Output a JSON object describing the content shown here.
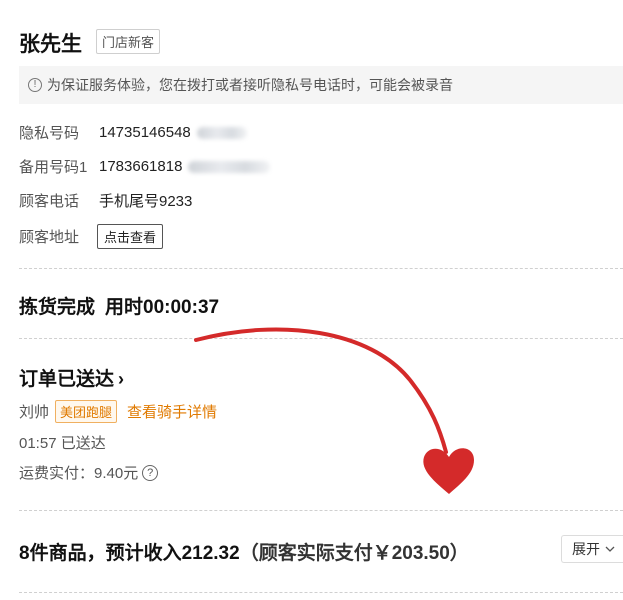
{
  "customer": {
    "name": "张先生",
    "tag": "门店新客",
    "notice": "为保证服务体验，您在拨打或者接听隐私号电话时，可能会被录音",
    "private_number_label": "隐私号码",
    "private_number": "14735146548",
    "backup_number_label": "备用号码1",
    "backup_number": "1783661818",
    "phone_label": "顾客电话",
    "phone_value": "手机尾号9233",
    "address_label": "顾客地址",
    "address_button": "点击查看"
  },
  "picking": {
    "status": "拣货完成",
    "time": "用时00:00:37"
  },
  "delivery": {
    "status": "订单已送达",
    "chevron": "›",
    "rider_name": "刘帅",
    "rider_tag": "美团跑腿",
    "rider_link": "查看骑手详情",
    "delivered_time": "01:57 已送达",
    "fee_label": "运费实付：",
    "fee_value": "9.40元",
    "help_icon": "?"
  },
  "summary": {
    "items_text": "8件商品，预计收入212.32",
    "paid_text": "（顾客实际支付￥203.50）",
    "expand_label": "展开",
    "expand_icon": "chevron-down-icon"
  },
  "colors": {
    "accent": "#e07a00",
    "annotation": "#d42a2a"
  }
}
